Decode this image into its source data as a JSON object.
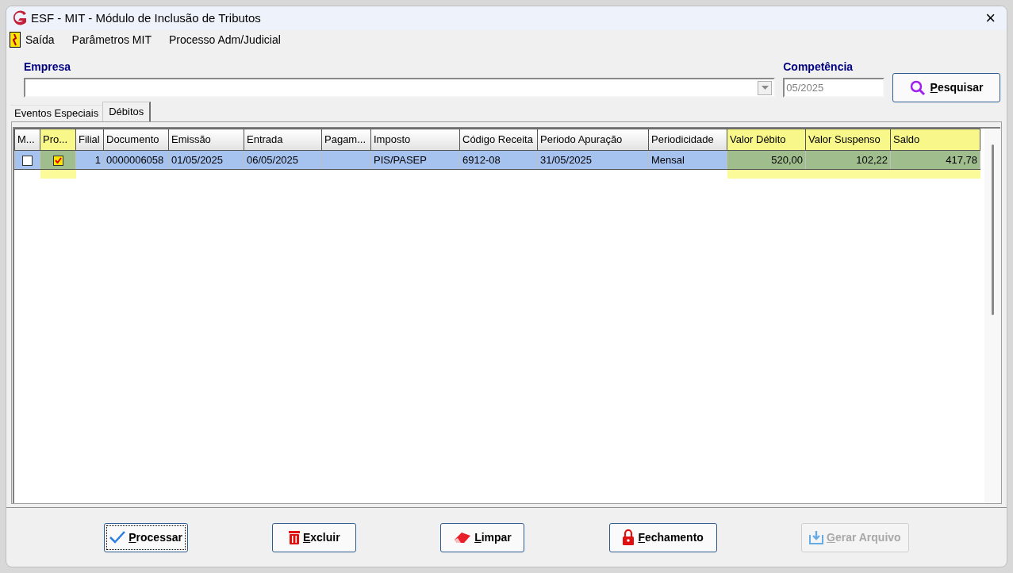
{
  "window": {
    "title": "ESF - MIT - Módulo de Inclusão de Tributos",
    "close": "×"
  },
  "menu": [
    {
      "label": "Saída",
      "kind": "exit"
    },
    {
      "label": "Parâmetros MIT",
      "kind": "plain"
    },
    {
      "label": "Processo Adm/Judicial",
      "kind": "plain"
    }
  ],
  "empresa": {
    "label": "Empresa"
  },
  "competencia": {
    "label": "Competência",
    "value": "05/2025"
  },
  "search_button": {
    "label": "Pesquisar"
  },
  "tabs": [
    {
      "label": "Eventos Especiais",
      "selected": false
    },
    {
      "label": "Débitos",
      "selected": true
    }
  ],
  "table": {
    "columns": [
      {
        "label": "M...",
        "highlighted": false,
        "kind": "text"
      },
      {
        "label": "Pro...",
        "highlighted": true,
        "kind": "text"
      },
      {
        "label": "Filial",
        "highlighted": false,
        "kind": "number"
      },
      {
        "label": "Documento",
        "highlighted": false,
        "kind": "text"
      },
      {
        "label": "Emissão",
        "highlighted": false,
        "kind": "text"
      },
      {
        "label": "Entrada",
        "highlighted": false,
        "kind": "text"
      },
      {
        "label": "Pagam...",
        "highlighted": false,
        "kind": "text"
      },
      {
        "label": "Imposto",
        "highlighted": false,
        "kind": "text"
      },
      {
        "label": "Código Receita",
        "highlighted": false,
        "kind": "text"
      },
      {
        "label": "Periodo Apuração",
        "highlighted": false,
        "kind": "text"
      },
      {
        "label": "Periodicidade",
        "highlighted": false,
        "kind": "text"
      },
      {
        "label": "Valor Débito",
        "highlighted": true,
        "kind": "number"
      },
      {
        "label": "Valor Suspenso",
        "highlighted": true,
        "kind": "number"
      },
      {
        "label": "Saldo",
        "highlighted": true,
        "kind": "number"
      }
    ],
    "rows": [
      {
        "selected": true,
        "cells": [
          {
            "kind": "checkbox",
            "checked": false
          },
          {
            "kind": "checkbox",
            "checked": true
          },
          {
            "kind": "text",
            "text": "1"
          },
          {
            "kind": "text",
            "text": "0000006058"
          },
          {
            "kind": "text",
            "text": "01/05/2025"
          },
          {
            "kind": "text",
            "text": "06/05/2025"
          },
          {
            "kind": "empty"
          },
          {
            "kind": "text",
            "text": "PIS/PASEP"
          },
          {
            "kind": "text",
            "text": "6912-08"
          },
          {
            "kind": "text",
            "text": "31/05/2025"
          },
          {
            "kind": "text",
            "text": "Mensal"
          },
          {
            "kind": "text",
            "text": "520,00"
          },
          {
            "kind": "text",
            "text": "102,22"
          },
          {
            "kind": "text",
            "text": "417,78"
          }
        ]
      }
    ]
  },
  "buttons": [
    {
      "label": "Processar",
      "kind": "check",
      "disabled": false,
      "focused": true
    },
    {
      "label": "Excluir",
      "kind": "trash",
      "disabled": false,
      "focused": false
    },
    {
      "label": "Limpar",
      "kind": "eraser",
      "disabled": false,
      "focused": false
    },
    {
      "label": "Fechamento",
      "kind": "lock",
      "disabled": false,
      "focused": false
    },
    {
      "label": "Gerar Arquivo",
      "kind": "download",
      "disabled": true,
      "focused": false
    }
  ]
}
